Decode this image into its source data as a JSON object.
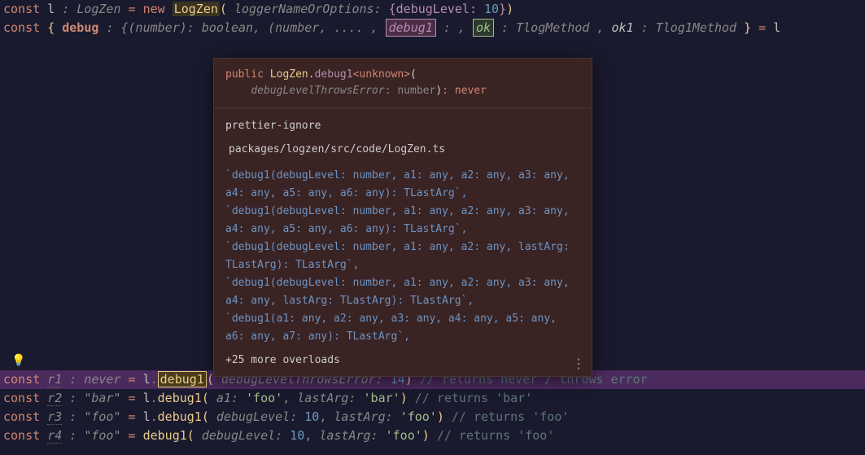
{
  "line1": {
    "const": "const",
    "var": "l",
    "type": "LogZen",
    "eq": "=",
    "new": "new",
    "ctor": "LogZen",
    "paramHint": "loggerNameOrOptions:",
    "optKey": "debugLevel:",
    "optVal": "10"
  },
  "line2": {
    "const": "const",
    "lbrace": "{",
    "debug": "debug",
    "debugType": ": {(number): boolean, (number, .... ,",
    "debug1": "debug1",
    "mid": ": ,",
    "ok": "ok",
    "okType": ": TlogMethod ,",
    "ok1": "ok1",
    "ok1Type": ": Tlog1Method",
    "rbrace": "}",
    "eq": "=",
    "rhs": "l"
  },
  "tooltip": {
    "sig": {
      "public": "public",
      "cls": "LogZen",
      "dot": ".",
      "method": "debug1",
      "gen": "<unknown>",
      "lp": "(",
      "param": "debugLevelThrowsError",
      "ptype": ": number",
      "rp": ")",
      "ret": ": never"
    },
    "title": "prettier-ignore",
    "path": "packages/logzen/src/code/LogZen.ts",
    "overloads": [
      "`debug1(debugLevel: number, a1: any, a2: any, a3: any, a4: any, a5: any, a6: any): TLastArg`,",
      "`debug1(debugLevel: number, a1: any, a2: any, a3: any, a4: any, a5: any, a6: any): TLastArg`,",
      "`debug1(debugLevel: number, a1: any, a2: any, lastArg: TLastArg): TLastArg`,",
      "`debug1(debugLevel: number, a1: any, a2: any, a3: any, a4: any, lastArg: TLastArg): TLastArg`,",
      "`debug1(a1: any, a2: any, a3: any, a4: any, a5: any, a6: any, a7: any): TLastArg`,"
    ],
    "more": "+25 more overloads"
  },
  "bulb": "💡",
  "dots": "⋮",
  "line_r1": {
    "const": "const",
    "var": "r1",
    "type": ": never",
    "eq": "=",
    "obj": "l",
    "dot": ".",
    "method": "debug1",
    "paramHint": "debugLevelThrowsError:",
    "val": "14",
    "comment": "// returns never / throws error"
  },
  "line_r2": {
    "const": "const",
    "var": "r2",
    "type": ": \"bar\"",
    "eq": "=",
    "obj": "l",
    "dot": ".",
    "method": "debug1",
    "p1hint": "a1:",
    "p1val": "'foo'",
    "comma": ",",
    "p2hint": "lastArg:",
    "p2val": "'bar'",
    "comment": "// returns 'bar'"
  },
  "line_r3": {
    "const": "const",
    "var": "r3",
    "type": ": \"foo\"",
    "eq": "=",
    "obj": "l",
    "dot": ".",
    "method": "debug1",
    "p1hint": "debugLevel:",
    "p1val": "10",
    "comma": ",",
    "p2hint": "lastArg:",
    "p2val": "'foo'",
    "comment": "// returns 'foo'"
  },
  "line_r4": {
    "const": "const",
    "var": "r4",
    "type": ": \"foo\"",
    "eq": "=",
    "method": "debug1",
    "p1hint": "debugLevel:",
    "p1val": "10",
    "comma": ",",
    "p2hint": "lastArg:",
    "p2val": "'foo'",
    "comment": "// returns 'foo'"
  }
}
